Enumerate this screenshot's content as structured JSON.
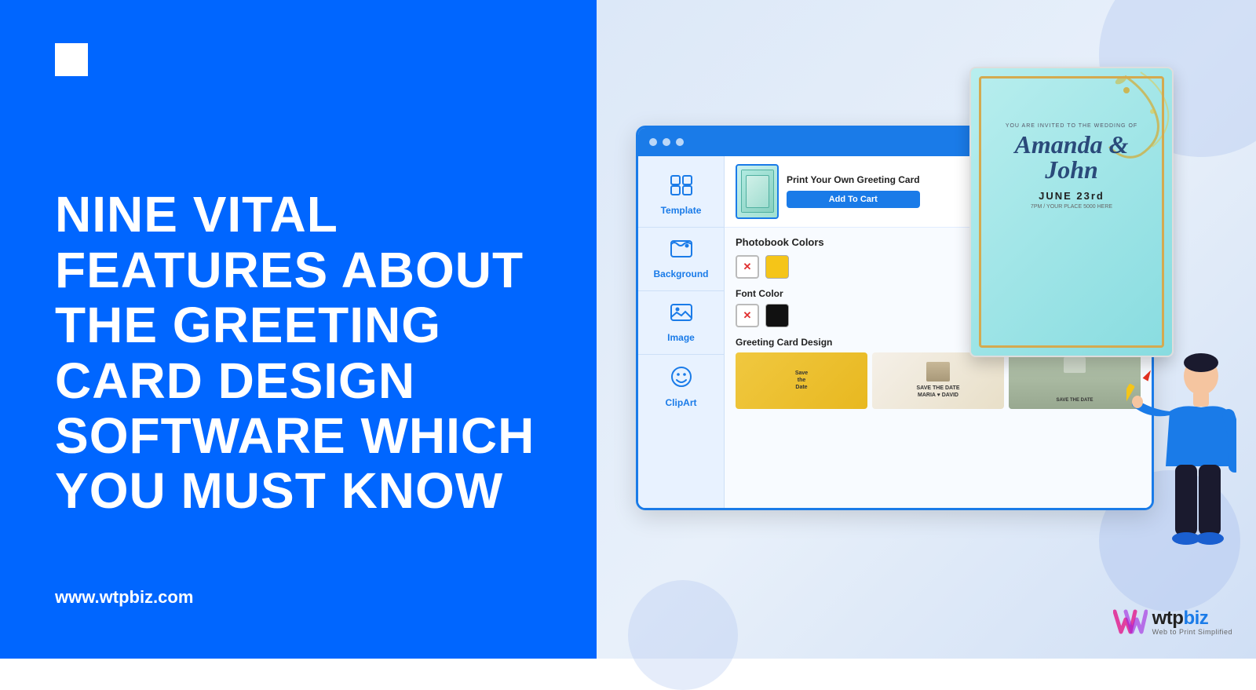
{
  "left": {
    "heading": "NINE VITAL FEATURES ABOUT THE GREETING CARD DESIGN SOFTWARE WHICH YOU MUST KNOW",
    "url": "www.wtpbiz.com"
  },
  "browser": {
    "sidebar": {
      "items": [
        {
          "id": "template",
          "label": "Template",
          "icon": "⊞"
        },
        {
          "id": "background",
          "label": "Background",
          "icon": "🎞"
        },
        {
          "id": "image",
          "label": "Image",
          "icon": "🖼"
        },
        {
          "id": "clipart",
          "label": "ClipArt",
          "icon": "😊"
        }
      ]
    },
    "product": {
      "title": "Print Your Own Greeting Card",
      "add_to_cart": "Add To Cart"
    },
    "sections": {
      "photobook_colors": {
        "title": "Photobook Colors",
        "colors": [
          "transparent-x",
          "#f5c518"
        ]
      },
      "font_color": {
        "title": "Font Color",
        "colors": [
          "transparent-x",
          "#111111"
        ]
      },
      "greeting_card_design": {
        "title": "Greeting Card Design"
      }
    }
  },
  "card": {
    "invited_text": "YOU ARE INVITED TO THE WEDDING OF",
    "name": "Amanda & John",
    "date": "JUNE 23rd",
    "sub_text": "7PM / YOUR PLACE 5000 HERE"
  },
  "logo": {
    "name_wtp": "wtp",
    "name_biz": "biz",
    "tagline": "Web to Print Simplified"
  }
}
